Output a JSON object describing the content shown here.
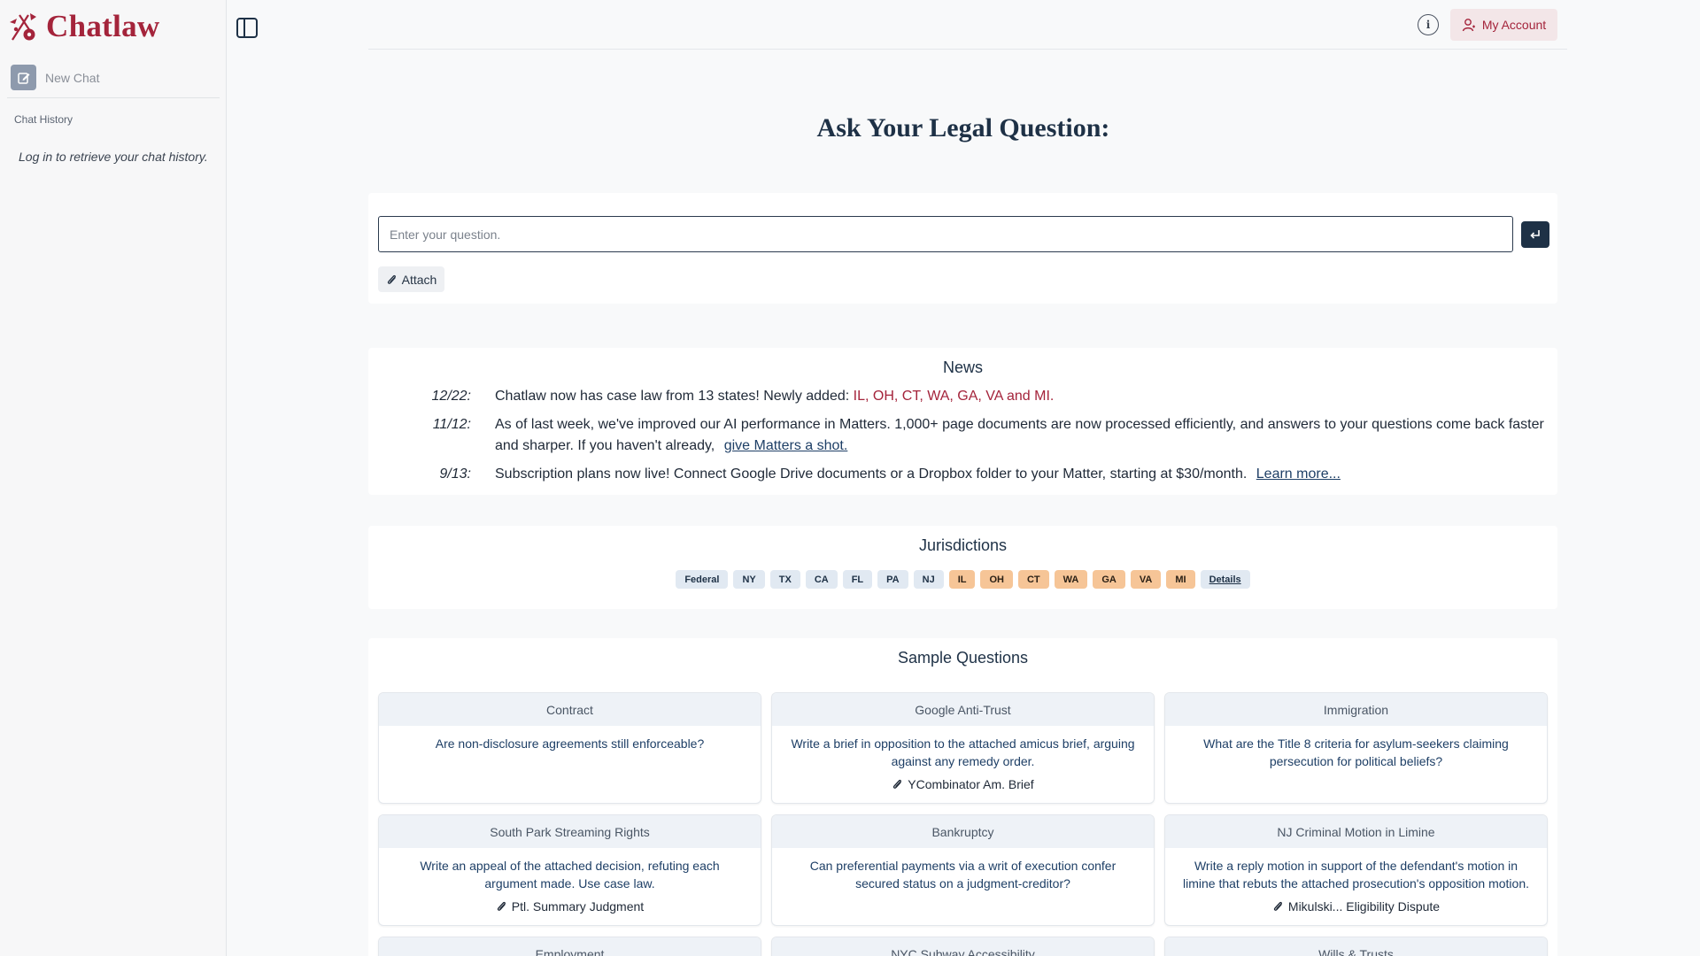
{
  "app": {
    "name": "Chatlaw",
    "brand_color": "#a4243b",
    "navy": "#1e3146"
  },
  "sidebar": {
    "new_chat_label": "New Chat",
    "history_title": "Chat History",
    "history_empty": "Log in to retrieve your chat history."
  },
  "header": {
    "account_label": "My Account",
    "info_icon": "info-icon"
  },
  "main": {
    "title": "Ask Your Legal Question:",
    "input_placeholder": "Enter your question.",
    "attach_label": "Attach"
  },
  "news": {
    "title": "News",
    "items": [
      {
        "date": "12/22:",
        "text": "Chatlaw now has case law from 13 states! Newly added: ",
        "highlight": "IL, OH, CT, WA, GA, VA and MI."
      },
      {
        "date": "11/12:",
        "text": "As of last week, we've improved our AI performance in Matters. 1,000+ page documents are now processed efficiently, and answers to your questions come back faster and sharper. If you haven't already, ",
        "link": "give Matters a shot."
      },
      {
        "date": "9/13:",
        "text": "Subscription plans now live! Connect Google Drive documents or a Dropbox folder to your Matter, starting at $30/month.",
        "link": "Learn more..."
      }
    ]
  },
  "jurisdictions": {
    "title": "Jurisdictions",
    "chips": [
      "Federal",
      "NY",
      "TX",
      "CA",
      "FL",
      "PA",
      "NJ",
      "IL",
      "OH",
      "CT",
      "WA",
      "GA",
      "VA",
      "MI",
      "Details"
    ]
  },
  "samples": {
    "title": "Sample Questions",
    "cards": [
      {
        "category": "Contract",
        "question": "Are non-disclosure agreements still enforceable?",
        "attachment": ""
      },
      {
        "category": "Google Anti-Trust",
        "question": "Write a brief in opposition to the attached amicus brief, arguing against any remedy order.",
        "attachment": "YCombinator Am. Brief"
      },
      {
        "category": "Immigration",
        "question": "What are the Title 8 criteria for asylum-seekers claiming persecution for political beliefs?",
        "attachment": ""
      },
      {
        "category": "South Park Streaming Rights",
        "question": "Write an appeal of the attached decision, refuting each argument made. Use case law.",
        "attachment": "Ptl. Summary Judgment"
      },
      {
        "category": "Bankruptcy",
        "question": "Can preferential payments via a writ of execution confer secured status on a judgment-creditor?",
        "attachment": ""
      },
      {
        "category": "NJ Criminal Motion in Limine",
        "question": "Write a reply motion in support of the defendant's motion in limine that rebuts the attached prosecution's opposition motion.",
        "attachment": "Mikulski... Eligibility Dispute"
      },
      {
        "category": "Employment",
        "question": "",
        "attachment": ""
      },
      {
        "category": "NYC Subway Accessibility",
        "question": "",
        "attachment": ""
      },
      {
        "category": "Wills & Trusts",
        "question": "",
        "attachment": ""
      }
    ]
  }
}
